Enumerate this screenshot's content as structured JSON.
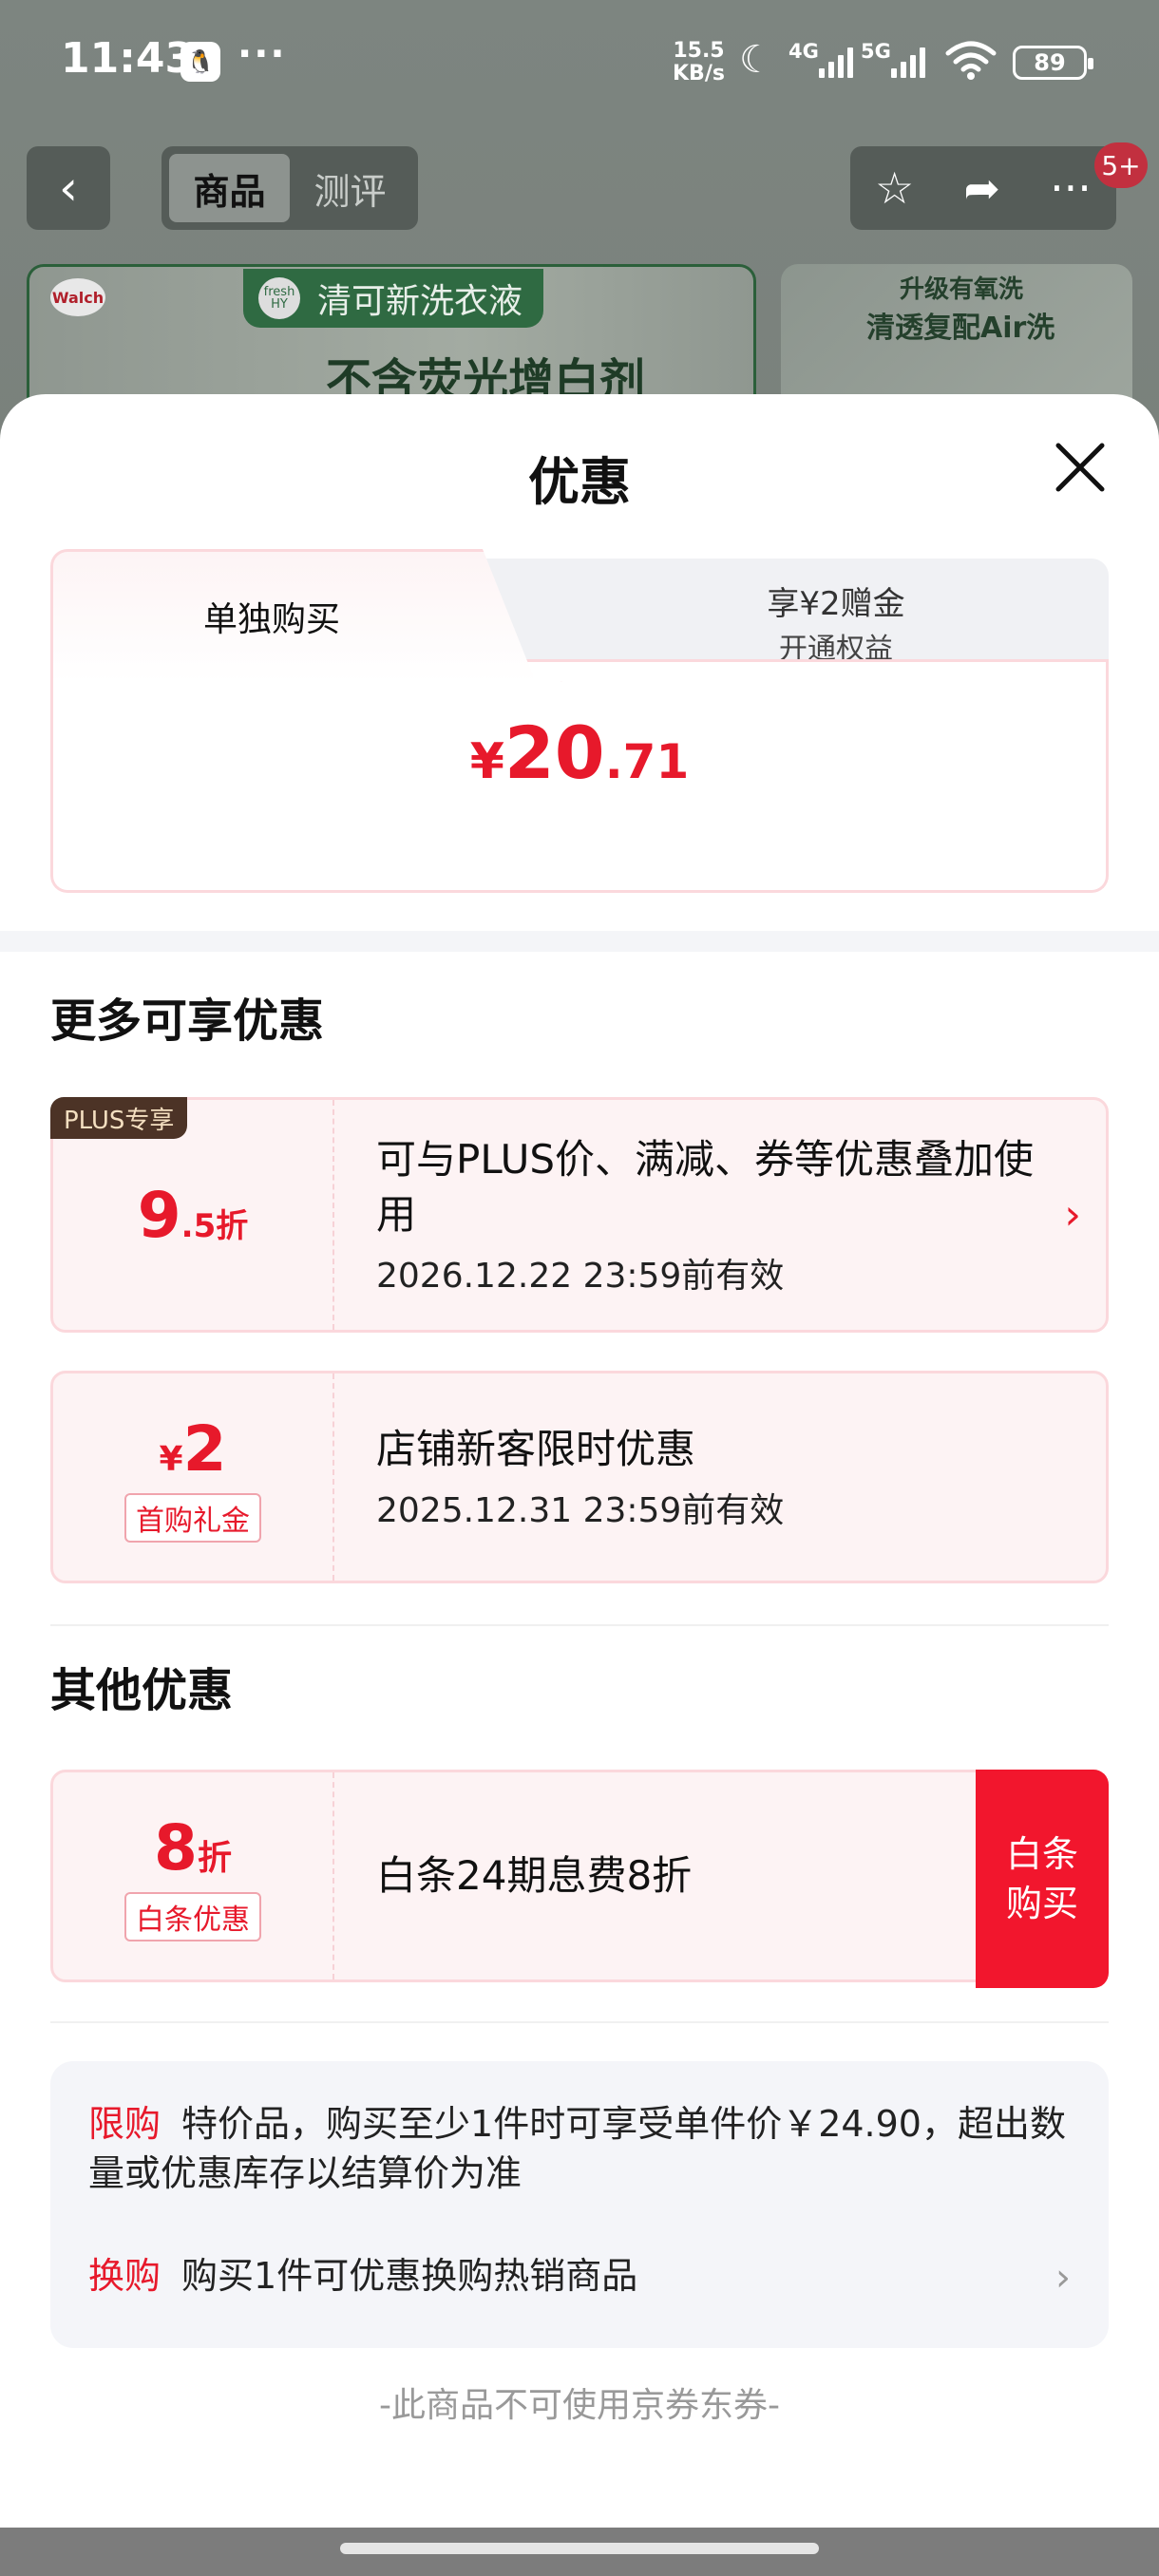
{
  "status_bar": {
    "time": "11:43",
    "app_icon": "qq-penguin-icon",
    "more": "···",
    "net_speed_value": "15.5",
    "net_speed_unit": "KB/s",
    "sig1": "4G",
    "sig2": "5G",
    "battery": "89"
  },
  "nav": {
    "tabs": [
      {
        "label": "商品"
      },
      {
        "label": "测评"
      }
    ],
    "badge": "5+"
  },
  "background_banner": {
    "logo": "Walch",
    "brand_tag": "清可新洗衣液",
    "brand_logo": "fresh HY",
    "title": "不含荧光增白剂",
    "right_sub": "升级有氧洗",
    "right_title": "清透复配Air洗"
  },
  "sheet": {
    "title": "优惠",
    "buy_tabs": {
      "left": "单独购买",
      "right_line1": "享¥2赠金",
      "right_line2": "开通权益"
    },
    "price": {
      "currency": "¥",
      "integer": "20",
      "decimal": ".71"
    },
    "more_title": "更多可享优惠",
    "coupons": [
      {
        "tag": "PLUS专享",
        "value_main": "9",
        "value_suffix": ".5折",
        "title": "可与PLUS价、满减、券等优惠叠加使用",
        "validity": "2026.12.22 23:59前有效"
      },
      {
        "currency": "¥",
        "value_main": "2",
        "pill": "首购礼金",
        "title": "店铺新客限时优惠",
        "validity": "2025.12.31 23:59前有效"
      }
    ],
    "other_title": "其他优惠",
    "baitiao": {
      "value_main": "8",
      "value_suffix": "折",
      "pill": "白条优惠",
      "title": "白条24期息费8折",
      "button": "白条\n购买"
    },
    "notes": [
      {
        "tag": "限购",
        "text": "特价品，购买至少1件时可享受单件价￥24.90，超出数量或优惠库存以结算价为准"
      },
      {
        "tag": "换购",
        "text": "购买1件可优惠换购热销商品"
      }
    ],
    "footer": "-此商品不可使用京券东券-"
  },
  "colors": {
    "accent_red": "#e7192b",
    "button_red": "#f2162d",
    "plus_brown": "#4c3326"
  }
}
